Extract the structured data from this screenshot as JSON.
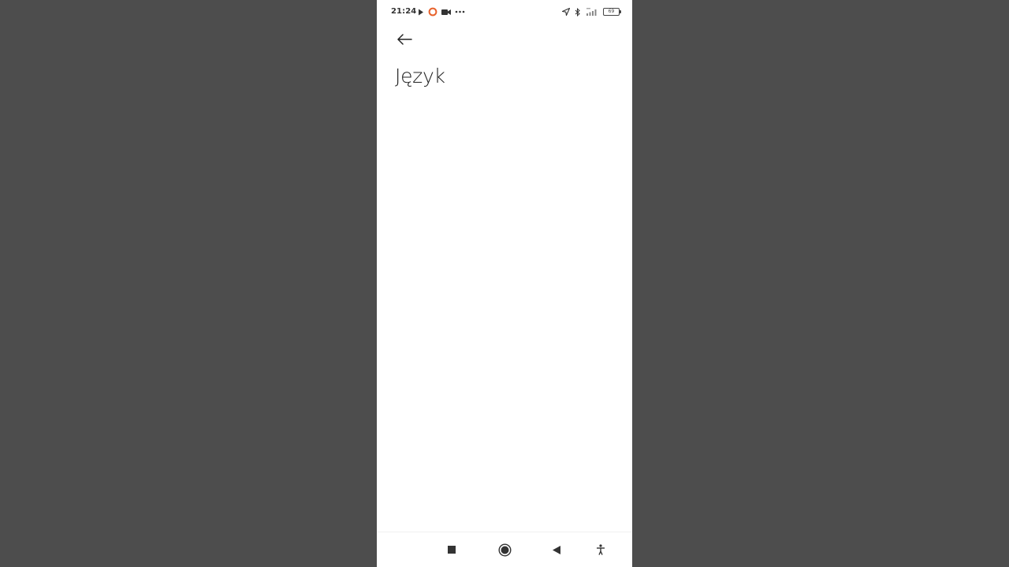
{
  "status_bar": {
    "time": "21:24",
    "battery_level": "69",
    "left_icons": [
      "play-icon",
      "screen-record-icon",
      "video-camera-icon",
      "more-dots-icon"
    ],
    "right_icons": [
      "location-icon",
      "bluetooth-icon",
      "signal-icon",
      "battery-icon"
    ],
    "record_color": "#e8622c"
  },
  "header": {
    "back_icon": "arrow-left-icon",
    "title": "Język"
  },
  "nav_bar": {
    "items": [
      "recents-square-icon",
      "home-circle-icon",
      "back-triangle-icon",
      "accessibility-icon"
    ]
  },
  "colors": {
    "backdrop": "#4d4d4d",
    "screen": "#ffffff",
    "text": "#222222"
  }
}
